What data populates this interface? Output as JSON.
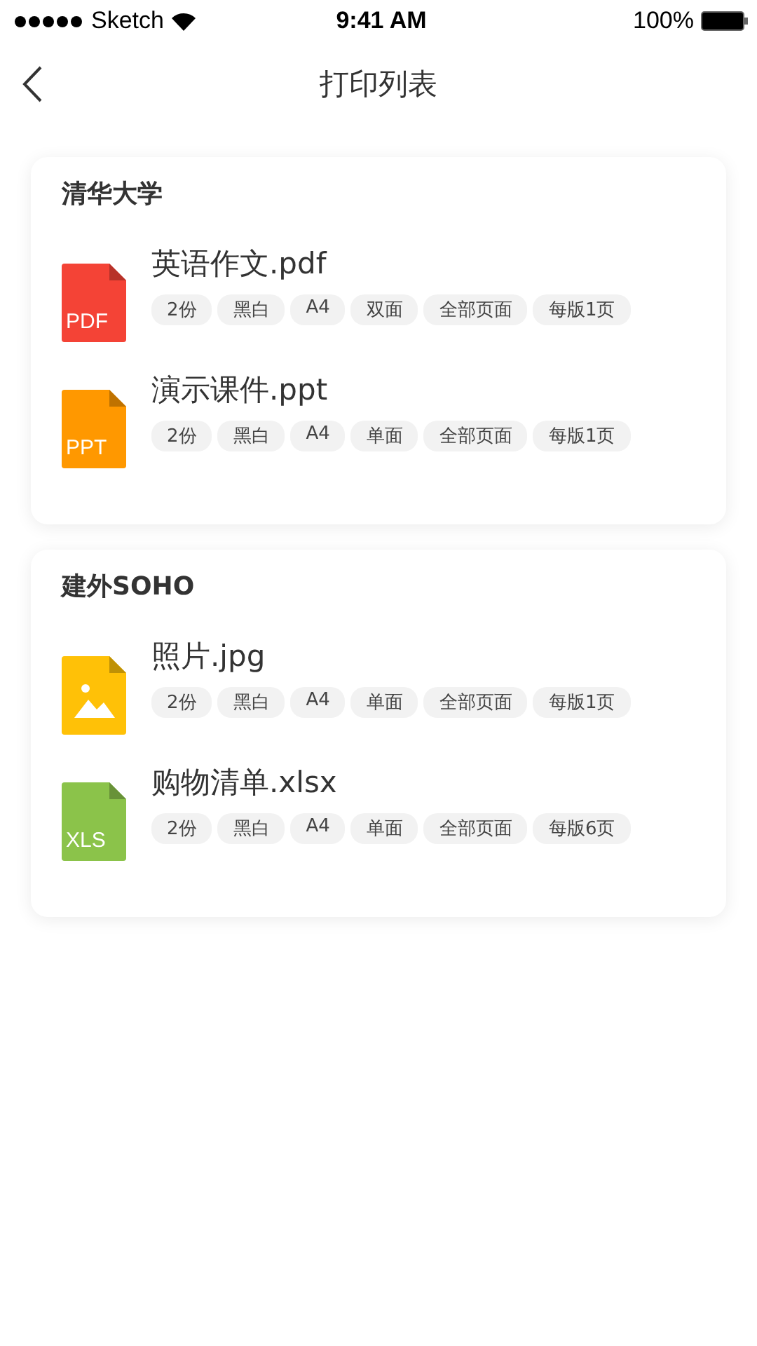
{
  "status_bar": {
    "carrier": "Sketch",
    "time": "9:41 AM",
    "battery": "100%"
  },
  "nav": {
    "title": "打印列表"
  },
  "groups": [
    {
      "name": "清华大学",
      "files": [
        {
          "name": "英语作文.pdf",
          "kind": "label",
          "icon_label": "PDF",
          "color": "#f44336",
          "tags": [
            "2份",
            "黑白",
            "A4",
            "双面",
            "全部页面",
            "每版1页"
          ]
        },
        {
          "name": "演示课件.ppt",
          "kind": "label",
          "icon_label": "PPT",
          "color": "#ff9800",
          "tags": [
            "2份",
            "黑白",
            "A4",
            "单面",
            "全部页面",
            "每版1页"
          ]
        }
      ]
    },
    {
      "name": "建外SOHO",
      "files": [
        {
          "name": "照片.jpg",
          "kind": "image",
          "color": "#ffc107",
          "tags": [
            "2份",
            "黑白",
            "A4",
            "单面",
            "全部页面",
            "每版1页"
          ]
        },
        {
          "name": "购物清单.xlsx",
          "kind": "label",
          "icon_label": "XLS",
          "color": "#8bc34a",
          "tags": [
            "2份",
            "黑白",
            "A4",
            "单面",
            "全部页面",
            "每版6页"
          ]
        }
      ]
    }
  ]
}
